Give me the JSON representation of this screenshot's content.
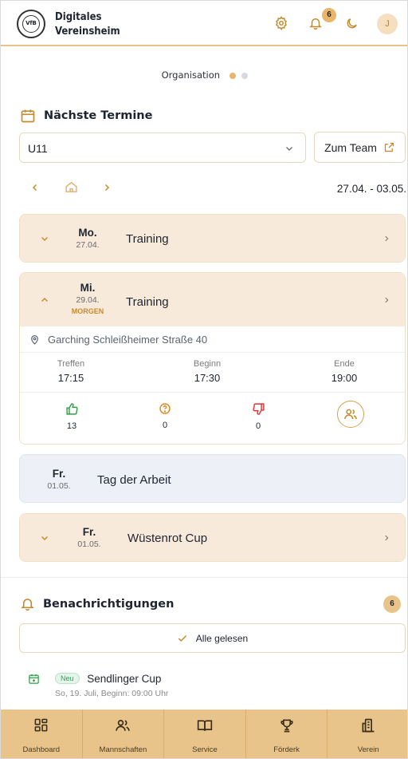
{
  "header": {
    "brand_line1": "Digitales",
    "brand_line2": "Vereinsheim",
    "logo_text": "VfB",
    "notification_count": "6",
    "avatar_initial": "J",
    "accent_color": "#e9c48a"
  },
  "org_pager": {
    "label": "Organisation",
    "active_index": 0,
    "count": 2
  },
  "termine": {
    "title": "Nächste Termine",
    "team_select_value": "U11",
    "team_button_label": "Zum Team",
    "date_range": "27.04. - 03.05."
  },
  "events": [
    {
      "weekday": "Mo.",
      "date": "27.04.",
      "title": "Training",
      "expanded": false
    },
    {
      "weekday": "Mi.",
      "date": "29.04.",
      "tag": "MORGEN",
      "title": "Training",
      "expanded": true,
      "location": "Garching Schleißheimer Straße 40",
      "times": [
        {
          "label": "Treffen",
          "value": "17:15"
        },
        {
          "label": "Beginn",
          "value": "17:30"
        },
        {
          "label": "Ende",
          "value": "19:00"
        }
      ],
      "votes": {
        "yes": "13",
        "maybe": "0",
        "no": "0"
      }
    },
    {
      "weekday": "Fr.",
      "date": "01.05.",
      "title": "Tag der Arbeit",
      "holiday": true
    },
    {
      "weekday": "Fr.",
      "date": "01.05.",
      "title": "Wüstenrot Cup",
      "expanded": false
    }
  ],
  "notifications": {
    "title": "Benachrichtigungen",
    "count": "6",
    "read_all_label": "Alle gelesen",
    "items": [
      {
        "badge": "Neu",
        "title": "Sendlinger Cup",
        "subtitle": "So, 19. Juli, Beginn: 09:00 Uhr"
      }
    ]
  },
  "bottom_nav": [
    {
      "label": "Dashboard",
      "icon": "dashboard-icon"
    },
    {
      "label": "Mannschaften",
      "icon": "users-icon"
    },
    {
      "label": "Service",
      "icon": "book-icon"
    },
    {
      "label": "Förderk",
      "icon": "trophy-icon"
    },
    {
      "label": "Verein",
      "icon": "building-icon"
    }
  ]
}
